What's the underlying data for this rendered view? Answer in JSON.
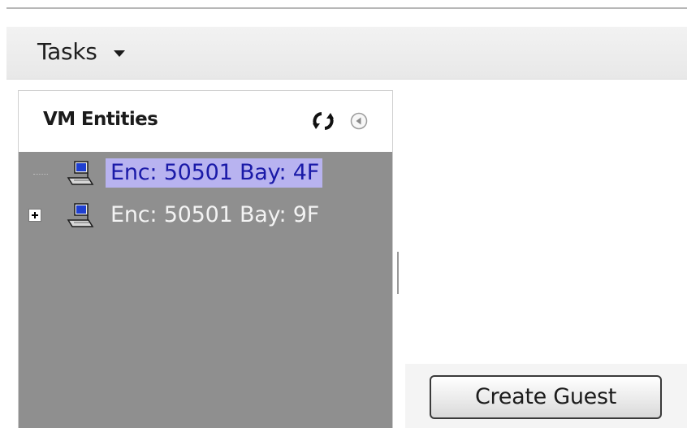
{
  "toolbar": {
    "tasks_label": "Tasks",
    "tasks_caret_icon": "caret-down-icon"
  },
  "panel": {
    "title": "VM Entities",
    "refresh_icon": "refresh-icon",
    "collapse_icon": "collapse-left-icon",
    "background_color": "#8f8f8f",
    "tree": [
      {
        "label": "Enc: 50501 Bay: 4F",
        "selected": true,
        "expandable": false,
        "icon": "virtual-machine-icon"
      },
      {
        "label": "Enc: 50501 Bay: 9F",
        "selected": false,
        "expandable": true,
        "icon": "virtual-machine-icon"
      }
    ]
  },
  "actions": {
    "create_guest_label": "Create Guest"
  },
  "colors": {
    "selection_bg": "#b8b3f0",
    "selection_text": "#1a1aa8"
  }
}
